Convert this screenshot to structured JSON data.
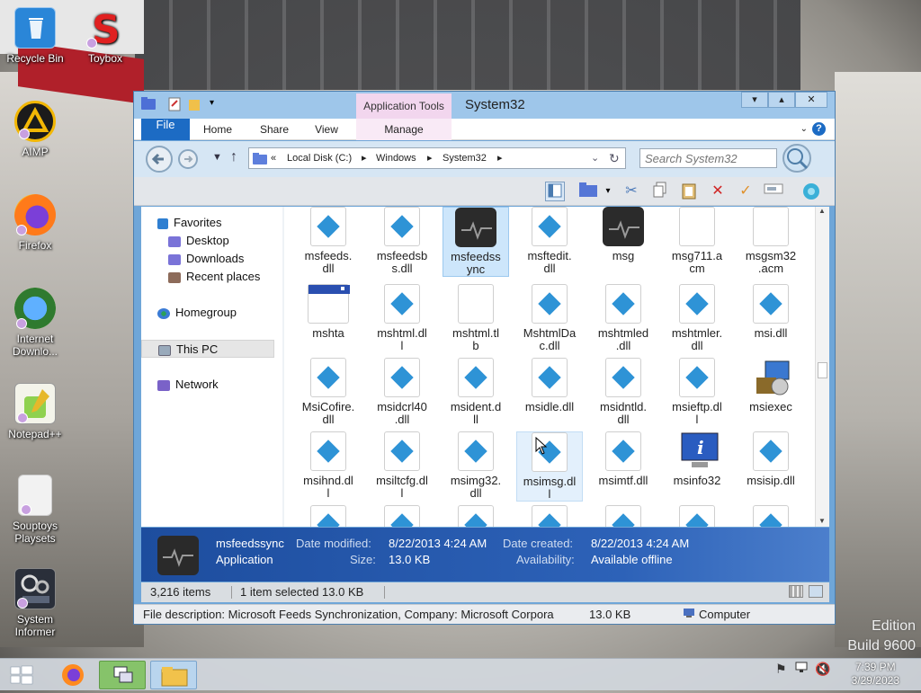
{
  "desktop": {
    "icons": [
      {
        "label": "Recycle Bin",
        "icon": "recycle-bin-icon"
      },
      {
        "label": "Toybox",
        "icon": "toybox-icon"
      },
      {
        "label": "AIMP",
        "icon": "aimp-icon"
      },
      {
        "label": "Firefox",
        "icon": "firefox-icon"
      },
      {
        "label": "Internet Downlo...",
        "icon": "internet-download-manager-icon"
      },
      {
        "label": "Notepad++",
        "icon": "notepad-plus-plus-icon"
      },
      {
        "label": "Souptoys Playsets",
        "icon": "souptoys-icon"
      },
      {
        "label": "System Informer",
        "icon": "system-informer-icon"
      }
    ],
    "watermark_edition": "Edition",
    "watermark_build": "Build 9600"
  },
  "window": {
    "title": "System32",
    "contextual_tab_group": "Application Tools",
    "ribbon_tabs": [
      "File",
      "Home",
      "Share",
      "View",
      "Manage"
    ],
    "address_parts": [
      "Local Disk (C:)",
      "Windows",
      "System32"
    ],
    "address_prefix": "«",
    "search_placeholder": "Search System32",
    "nav": {
      "favorites": "Favorites",
      "desktop": "Desktop",
      "downloads": "Downloads",
      "recent": "Recent places",
      "homegroup": "Homegroup",
      "thispc": "This PC",
      "network": "Network"
    },
    "files": [
      {
        "name": "msfeeds.\ndll",
        "type": "dll"
      },
      {
        "name": "msfeedsb\ns.dll",
        "type": "dll"
      },
      {
        "name": "msfeedss\nync",
        "type": "app",
        "selected": true
      },
      {
        "name": "msftedit.\ndll",
        "type": "dll"
      },
      {
        "name": "msg",
        "type": "app"
      },
      {
        "name": "msg711.a\ncm",
        "type": "blank"
      },
      {
        "name": "msgsm32\n.acm",
        "type": "blank"
      },
      {
        "name": "mshta",
        "type": "window"
      },
      {
        "name": "mshtml.dl\nl",
        "type": "dll"
      },
      {
        "name": "mshtml.tl\nb",
        "type": "blank"
      },
      {
        "name": "MshtmlDa\nc.dll",
        "type": "dll"
      },
      {
        "name": "mshtmled\n.dll",
        "type": "dll"
      },
      {
        "name": "mshtmler.\ndll",
        "type": "dll"
      },
      {
        "name": "msi.dll",
        "type": "dll"
      },
      {
        "name": "MsiCofire.\ndll",
        "type": "dll"
      },
      {
        "name": "msidcrl40\n.dll",
        "type": "dll"
      },
      {
        "name": "msident.d\nll",
        "type": "dll"
      },
      {
        "name": "msidle.dll",
        "type": "dll"
      },
      {
        "name": "msidntld.\ndll",
        "type": "dll"
      },
      {
        "name": "msieftp.dl\nl",
        "type": "dll"
      },
      {
        "name": "msiexec",
        "type": "installer"
      },
      {
        "name": "msihnd.dl\nl",
        "type": "dll"
      },
      {
        "name": "msiltcfg.dl\nl",
        "type": "dll"
      },
      {
        "name": "msimg32.\ndll",
        "type": "dll"
      },
      {
        "name": "msimsg.dl\nl",
        "type": "dll",
        "hover": true
      },
      {
        "name": "msimtf.dll",
        "type": "dll"
      },
      {
        "name": "msinfo32",
        "type": "info"
      },
      {
        "name": "msisip.dll",
        "type": "dll"
      }
    ],
    "details": {
      "name": "msfeedssync",
      "type": "Application",
      "modified_label": "Date modified:",
      "modified": "8/22/2013 4:24 AM",
      "created_label": "Date created:",
      "created": "8/22/2013 4:24 AM",
      "size_label": "Size:",
      "size": "13.0 KB",
      "availability_label": "Availability:",
      "availability": "Available offline"
    },
    "status": {
      "items": "3,216 items",
      "selected": "1 item selected  13.0 KB"
    },
    "infobar": {
      "description": "File description: Microsoft Feeds Synchronization, Company: Microsoft Corpora",
      "size": "13.0 KB",
      "location": "Computer"
    }
  },
  "taskbar": {
    "time": "7:39 PM",
    "date": "3/29/2023"
  },
  "colors": {
    "accent": "#1c6bc4",
    "details_bar": "#2d62b8",
    "selection": "#cde6fb"
  }
}
